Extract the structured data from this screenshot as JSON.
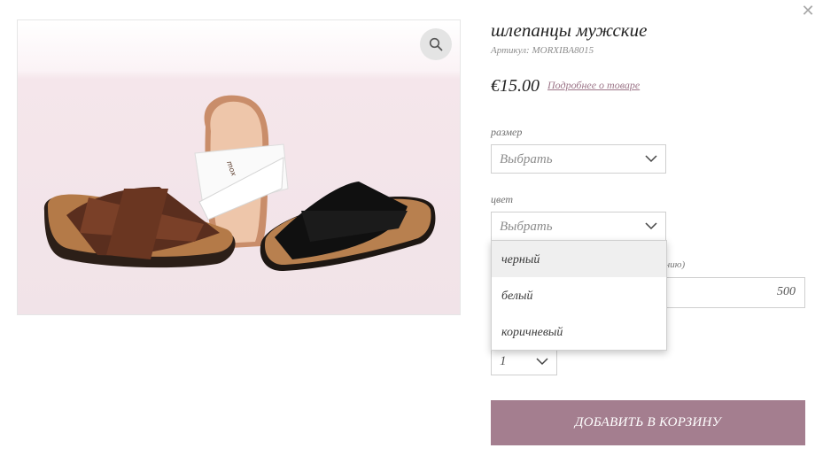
{
  "modal": {
    "close_symbol": "✕"
  },
  "product": {
    "title": "шлепанцы мужские",
    "sku_label": "Артикул:",
    "sku_value": "MORXIBA8015",
    "price": "€15.00",
    "details_link": "Подробнее о товаре",
    "image_alt_colors": [
      "brown",
      "white",
      "black"
    ]
  },
  "options": {
    "size": {
      "label": "размер",
      "value": "Выбрать"
    },
    "color": {
      "label": "цвет",
      "value": "Выбрать",
      "dropdown_open": true,
      "items": [
        "черный",
        "белый",
        "коричневый"
      ],
      "hovered_index": 0
    },
    "hidden_field": {
      "label_partial": "кепанию)",
      "value": "500"
    },
    "quantity": {
      "value": "1"
    }
  },
  "actions": {
    "add_to_cart": "ДОБАВИТЬ В КОРЗИНУ"
  },
  "colors": {
    "accent": "#a47e8f",
    "link": "#9c7588"
  },
  "icons": {
    "zoom": "magnifier-icon",
    "close": "close-icon",
    "chevron": "chevron-down-icon"
  }
}
